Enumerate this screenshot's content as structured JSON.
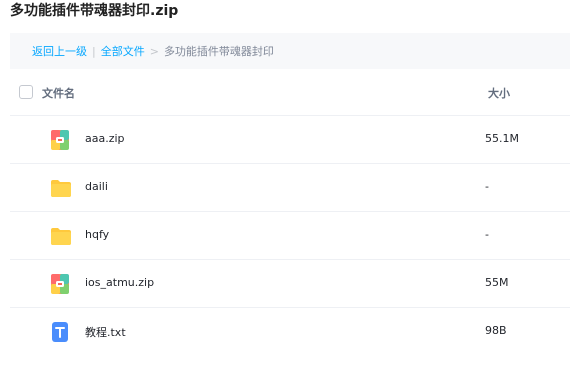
{
  "window": {
    "title": "多功能插件带魂器封印.zip"
  },
  "breadcrumb": {
    "back_label": "返回上一级",
    "separator": "|",
    "all_files_label": "全部文件",
    "arrow": ">",
    "current_label": "多功能插件带魂器封印"
  },
  "table": {
    "headers": {
      "name": "文件名",
      "size": "大小"
    },
    "rows": [
      {
        "name": "aaa.zip",
        "size": "55.1M",
        "icon": "zip-archive-icon"
      },
      {
        "name": "daili",
        "size": "-",
        "icon": "folder-icon"
      },
      {
        "name": "hqfy",
        "size": "-",
        "icon": "folder-icon"
      },
      {
        "name": "ios_atmu.zip",
        "size": "55M",
        "icon": "zip-archive-icon"
      },
      {
        "name": "教程.txt",
        "size": "98B",
        "icon": "text-file-icon"
      }
    ]
  },
  "colors": {
    "link": "#06a7ff",
    "folder": "#ffc93d",
    "text_file": "#4a8dfc",
    "breadcrumb_bg": "#f7f8fa"
  }
}
